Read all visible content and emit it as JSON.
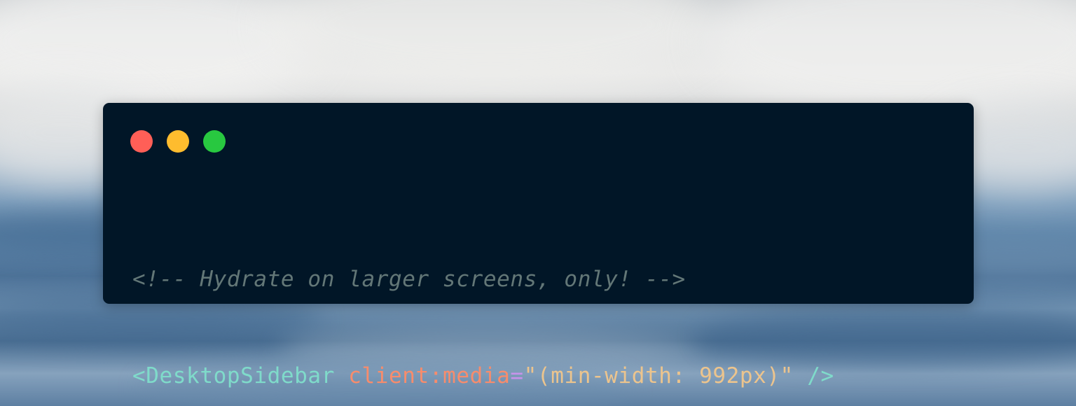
{
  "window": {
    "controls": [
      {
        "name": "close",
        "color": "#ff5f57"
      },
      {
        "name": "minimize",
        "color": "#febc2e"
      },
      {
        "name": "maximize",
        "color": "#28c840"
      }
    ],
    "background_color": "#011627"
  },
  "code": {
    "comment": "<!-- Hydrate on larger screens, only! -->",
    "open_bracket": "<",
    "component": "DesktopSidebar",
    "attribute": "client:media",
    "equals": "=",
    "value": "\"(min-width: 992px)\"",
    "self_close": "/>"
  },
  "colors": {
    "comment": "#637777",
    "tag": "#7fdbca",
    "attribute": "#f78c6c",
    "value": "#ecc48d"
  }
}
